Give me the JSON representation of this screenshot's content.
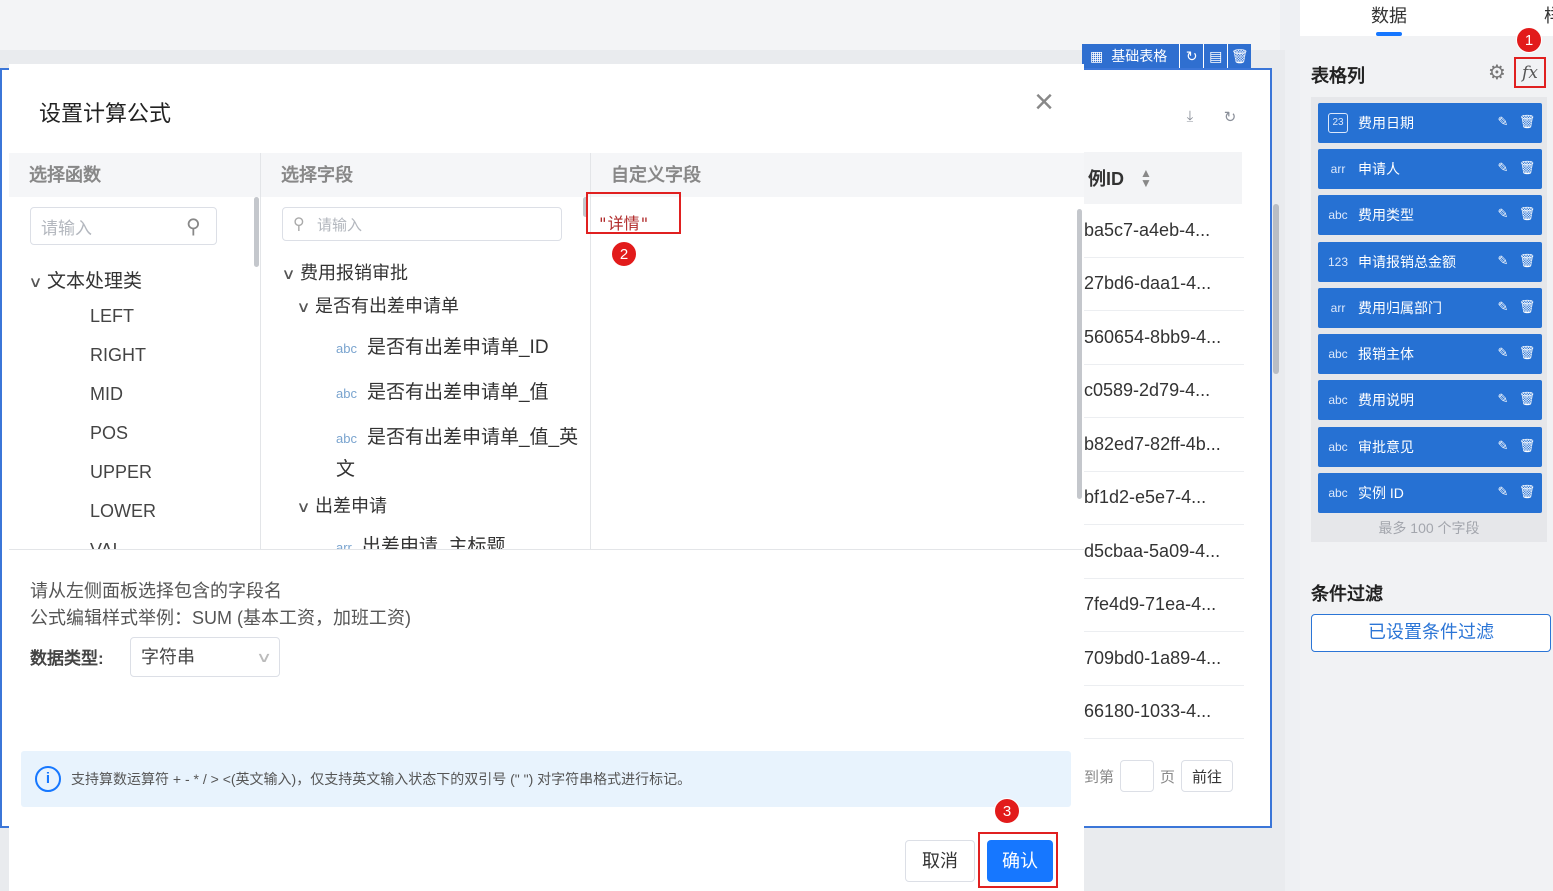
{
  "background": {
    "card_tag_label": "基础表格",
    "column_header": "例ID",
    "rows": [
      "ba5c7-a4eb-4...",
      "27bd6-daa1-4...",
      "560654-8bb9-4...",
      "c0589-2d79-4...",
      "b82ed7-82ff-4b...",
      "bf1d2-e5e7-4...",
      "d5cbaa-5a09-4...",
      "7fe4d9-71ea-4...",
      "709bd0-1a89-4...",
      "66180-1033-4..."
    ],
    "pager": {
      "prefix": "到第",
      "suffix": "页",
      "go_label": "前往"
    }
  },
  "right_panel": {
    "tabs": [
      "数据",
      "样"
    ],
    "columns_title": "表格列",
    "columns": [
      {
        "type": "23",
        "name": "费用日期"
      },
      {
        "type": "arr",
        "name": "申请人"
      },
      {
        "type": "abc",
        "name": "费用类型"
      },
      {
        "type": "123",
        "name": "申请报销总金额"
      },
      {
        "type": "arr",
        "name": "费用归属部门"
      },
      {
        "type": "abc",
        "name": "报销主体"
      },
      {
        "type": "abc",
        "name": "费用说明"
      },
      {
        "type": "abc",
        "name": "审批意见"
      },
      {
        "type": "abc",
        "name": "实例 ID"
      }
    ],
    "columns_max": "最多 100 个字段",
    "filter_title": "条件过滤",
    "filter_button": "已设置条件过滤",
    "fx_label": "fx"
  },
  "annotations": {
    "badge1": "1",
    "badge2": "2",
    "badge3": "3"
  },
  "modal": {
    "title": "设置计算公式",
    "func_header": "选择函数",
    "field_header": "选择字段",
    "custom_header": "自定义字段",
    "func_search_placeholder": "请输入",
    "field_search_placeholder": "请输入",
    "func_group": "文本处理类",
    "functions": [
      "LEFT",
      "RIGHT",
      "MID",
      "POS",
      "UPPER",
      "LOWER",
      "VAL"
    ],
    "field_tree": {
      "root": "费用报销审批",
      "group1": "是否有出差申请单",
      "group1_items": [
        {
          "type": "abc",
          "name": "是否有出差申请单_ID"
        },
        {
          "type": "abc",
          "name": "是否有出差申请单_值"
        },
        {
          "type": "abc",
          "name": "是否有出差申请单_值_英"
        }
      ],
      "group1_item_wrap": "文",
      "group2": "出差申请",
      "group2_items": [
        {
          "type": "arr",
          "name": "出差申请_主标题"
        }
      ]
    },
    "formula": "\"详情\"",
    "hint_line1": "请从左侧面板选择包含的字段名",
    "hint_line2": "公式编辑样式举例：SUM (基本工资，加班工资)",
    "data_type_label": "数据类型:",
    "data_type_value": "字符串",
    "info_text": "支持算数运算符 + - * / > <(英文输入)，仅支持英文输入状态下的双引号 (\" \") 对字符串格式进行标记。",
    "cancel_label": "取消",
    "confirm_label": "确认"
  },
  "colors": {
    "accent": "#1677ff",
    "column_item": "#2671d3",
    "annotation_red": "#e02020"
  }
}
